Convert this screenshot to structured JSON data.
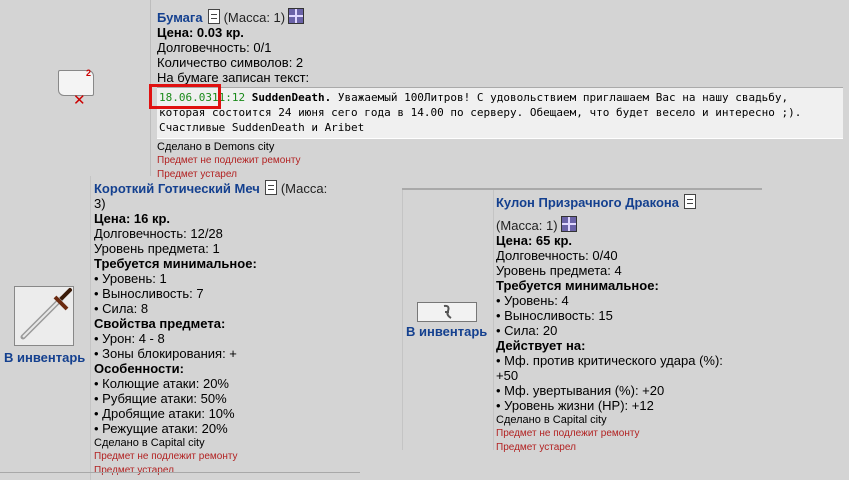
{
  "paper": {
    "title": "Бумага",
    "mass": "(Масса: 1)",
    "price": "Цена: 0.03 кр.",
    "durability": "Долговечность: 0/1",
    "symbols": "Количество символов: 2",
    "text_label": "На бумаге записан текст:",
    "note_date": "18.06.03",
    "note_time": "11:12",
    "note_author": "SuddenDeath.",
    "note_text": " Уважаемый 100Литров! С удовольствием приглашаем Вас на нашу свадьбу, которая состоится 24 июня сего года в 14.00 по серверу. Обещаем, что будет весело и интересно ;). Счастливые SuddenDeath и Aribet",
    "made_in": "Сделано в Demons city",
    "not_repairable": "Предмет не подлежит ремонту",
    "obsolete": "Предмет устарел",
    "icon_count": "2"
  },
  "sword": {
    "title": "Короткий Готический Меч",
    "mass_line1": "(Масса:",
    "mass_line2": "3)",
    "price": "Цена: 16 кр.",
    "durability": "Долговечность: 12/28",
    "level": "Уровень предмета: 1",
    "req_header": "Требуется минимальное:",
    "req": [
      "• Уровень: 1",
      "• Выносливость: 7",
      "• Сила: 8"
    ],
    "props_header": "Свойства предмета:",
    "props": [
      "• Урон: 4 - 8",
      "• Зоны блокирования: +"
    ],
    "features_header": "Особенности:",
    "features": [
      "• Колющие атаки: 20%",
      "• Рубящие атаки: 50%",
      "• Дробящие атаки: 10%",
      "• Режущие атаки: 20%"
    ],
    "made_in": "Сделано в Capital city",
    "not_repairable": "Предмет не подлежит ремонту",
    "obsolete": "Предмет устарел",
    "inventory_link": "В инвентарь"
  },
  "amulet": {
    "title": "Кулон Призрачного Дракона",
    "mass": "(Масса: 1)",
    "price": "Цена: 65 кр.",
    "durability": "Долговечность: 0/40",
    "level": "Уровень предмета: 4",
    "req_header": "Требуется минимальное:",
    "req": [
      "• Уровень: 4",
      "• Выносливость: 15",
      "• Сила: 20"
    ],
    "acts_header": "Действует на:",
    "acts": [
      "• Мф. против критического удара (%):",
      "+50",
      "• Мф. увертывания (%): +20",
      "• Уровень жизни (HP): +12"
    ],
    "made_in": "Сделано в Capital city",
    "not_repairable": "Предмет не подлежит ремонту",
    "obsolete": "Предмет устарел",
    "inventory_link": "В инвентарь"
  }
}
